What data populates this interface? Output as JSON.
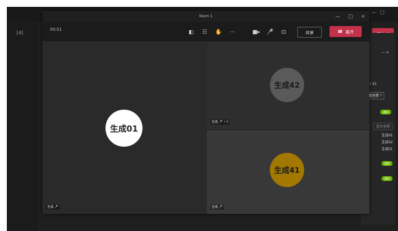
{
  "background_app": {
    "left_label": "[4]",
    "window_controls": [
      "—",
      "□"
    ],
    "red_chip": "加入 ˅"
  },
  "side_panel": {
    "items": [
      {
        "type": "text",
        "label": "— ×"
      },
      {
        "type": "text",
        "label": "• 01"
      },
      {
        "type": "box",
        "label": "加载全部 ?"
      },
      {
        "type": "pill",
        "label": "通知"
      },
      {
        "type": "box",
        "label": "显示全部"
      },
      {
        "type": "text",
        "label": "生成41"
      },
      {
        "type": "text",
        "label": "生成42"
      },
      {
        "type": "text",
        "label": "生成01"
      },
      {
        "type": "pill",
        "label": "通知"
      },
      {
        "type": "pill",
        "label": "通知"
      }
    ]
  },
  "meeting": {
    "title": "Room 1",
    "window_controls": [
      "—",
      "□",
      "×"
    ],
    "timer": "00:01",
    "toolbar_icons": [
      "chat-icon",
      "participants-icon",
      "raise-hand-icon",
      "more-icon",
      "camera-icon",
      "mic-icon",
      "screen-share-icon"
    ],
    "toolbar_glyphs": [
      "◧",
      "☷",
      "✋",
      "⋯",
      "■▸",
      "🎤",
      "⊡"
    ],
    "share_label": "共享",
    "leave_label": "离开",
    "leave_icon_glyph": "☎",
    "participants": [
      {
        "id": "01",
        "name": "生成01",
        "tag": "生成 🎤"
      },
      {
        "id": "42",
        "name": "生成42",
        "tag": "生成 🎤 • 1"
      },
      {
        "id": "41",
        "name": "生成41",
        "tag": "生成 🎤"
      }
    ]
  }
}
